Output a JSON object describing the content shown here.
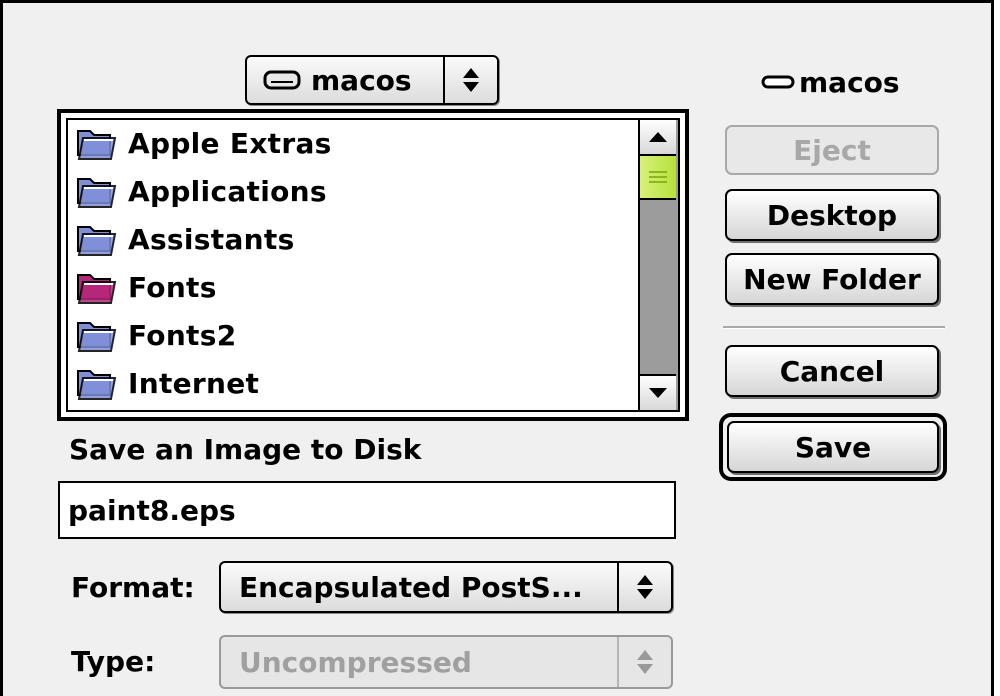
{
  "volume_popup": {
    "label": "macos",
    "icon": "hard-disk-icon"
  },
  "volume_info": {
    "label": "macos",
    "icon": "disk-icon"
  },
  "file_list": {
    "items": [
      {
        "name": "Apple Extras",
        "icon": "folder-icon",
        "color": "#7f8fd8"
      },
      {
        "name": "Applications",
        "icon": "folder-icon",
        "color": "#7f8fd8"
      },
      {
        "name": "Assistants",
        "icon": "folder-icon",
        "color": "#7f8fd8"
      },
      {
        "name": "Fonts",
        "icon": "fonts-folder-icon",
        "color": "#b4277a"
      },
      {
        "name": "Fonts2",
        "icon": "folder-icon",
        "color": "#7f8fd8"
      },
      {
        "name": "Internet",
        "icon": "folder-icon",
        "color": "#7f8fd8"
      }
    ]
  },
  "buttons": {
    "eject": "Eject",
    "desktop": "Desktop",
    "new_folder": "New Folder",
    "cancel": "Cancel",
    "save": "Save"
  },
  "prompt": "Save an Image to Disk",
  "filename": "paint8.eps",
  "format": {
    "label": "Format:",
    "value": "Encapsulated PostS..."
  },
  "type": {
    "label": "Type:",
    "value": "Uncompressed"
  },
  "colors": {
    "scroll_thumb": "#c6ea55",
    "default_folder": "#7f8fd8",
    "fonts_folder": "#b4277a"
  }
}
